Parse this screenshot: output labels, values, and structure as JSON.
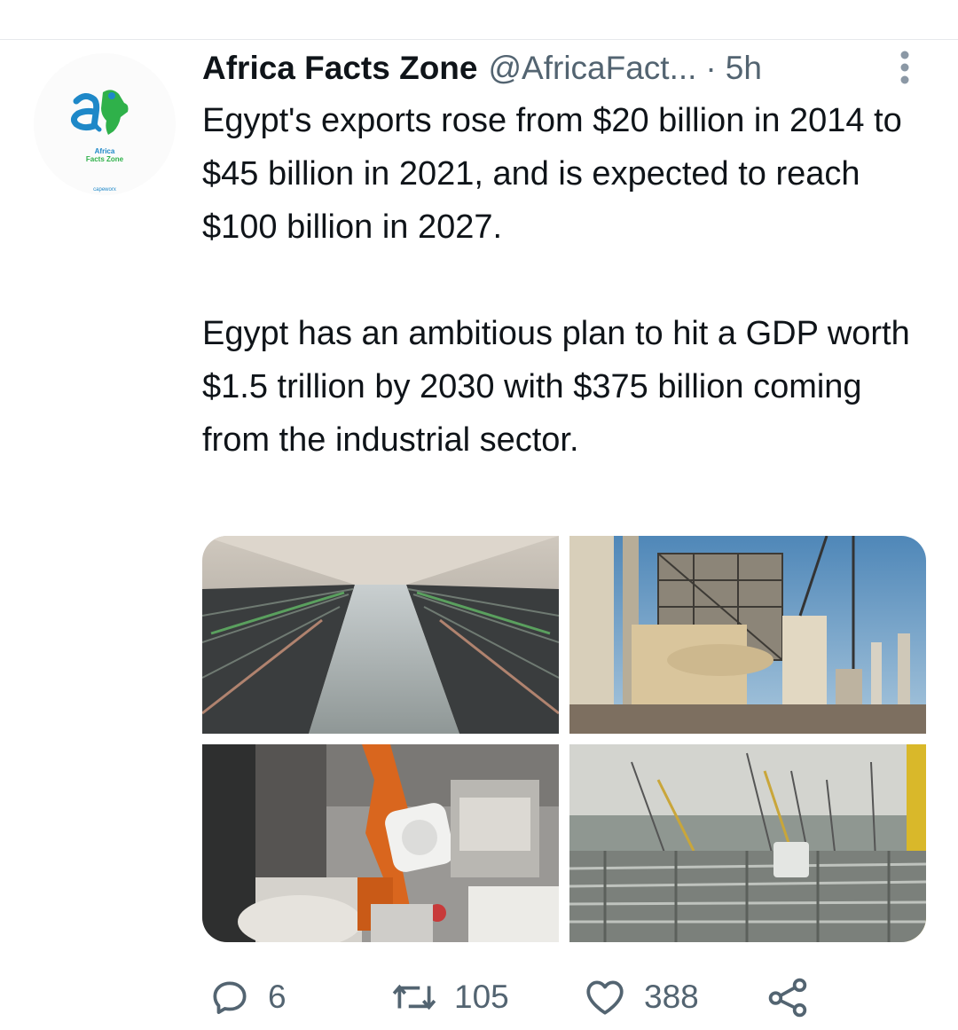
{
  "tweet": {
    "author": {
      "display_name": "Africa Facts Zone",
      "handle": "@AfricaFact...",
      "avatar_text": "Africa Facts Zone",
      "avatar_subtext": "capeworx"
    },
    "separator": "·",
    "time": "5h",
    "text": {
      "paragraph_1": "Egypt's exports rose from $20 billion in 2014 to $45 billion in 2021, and is expected to reach $100 billion in 2027.",
      "paragraph_2": "Egypt has an ambitious plan to hit a GDP worth $1.5 trillion by 2030 with $375 billion coming from the industrial sector."
    },
    "media": [
      {
        "name": "textile-factory-photo"
      },
      {
        "name": "power-plant-photo"
      },
      {
        "name": "robotic-arm-photo"
      },
      {
        "name": "construction-site-photo"
      }
    ],
    "actions": {
      "replies": "6",
      "retweets": "105",
      "likes": "388"
    }
  },
  "colors": {
    "text": "#0f1419",
    "secondary": "#536471",
    "divider": "#e6e9ec",
    "logo_blue": "#1e88c8",
    "logo_green": "#2fb14a"
  }
}
